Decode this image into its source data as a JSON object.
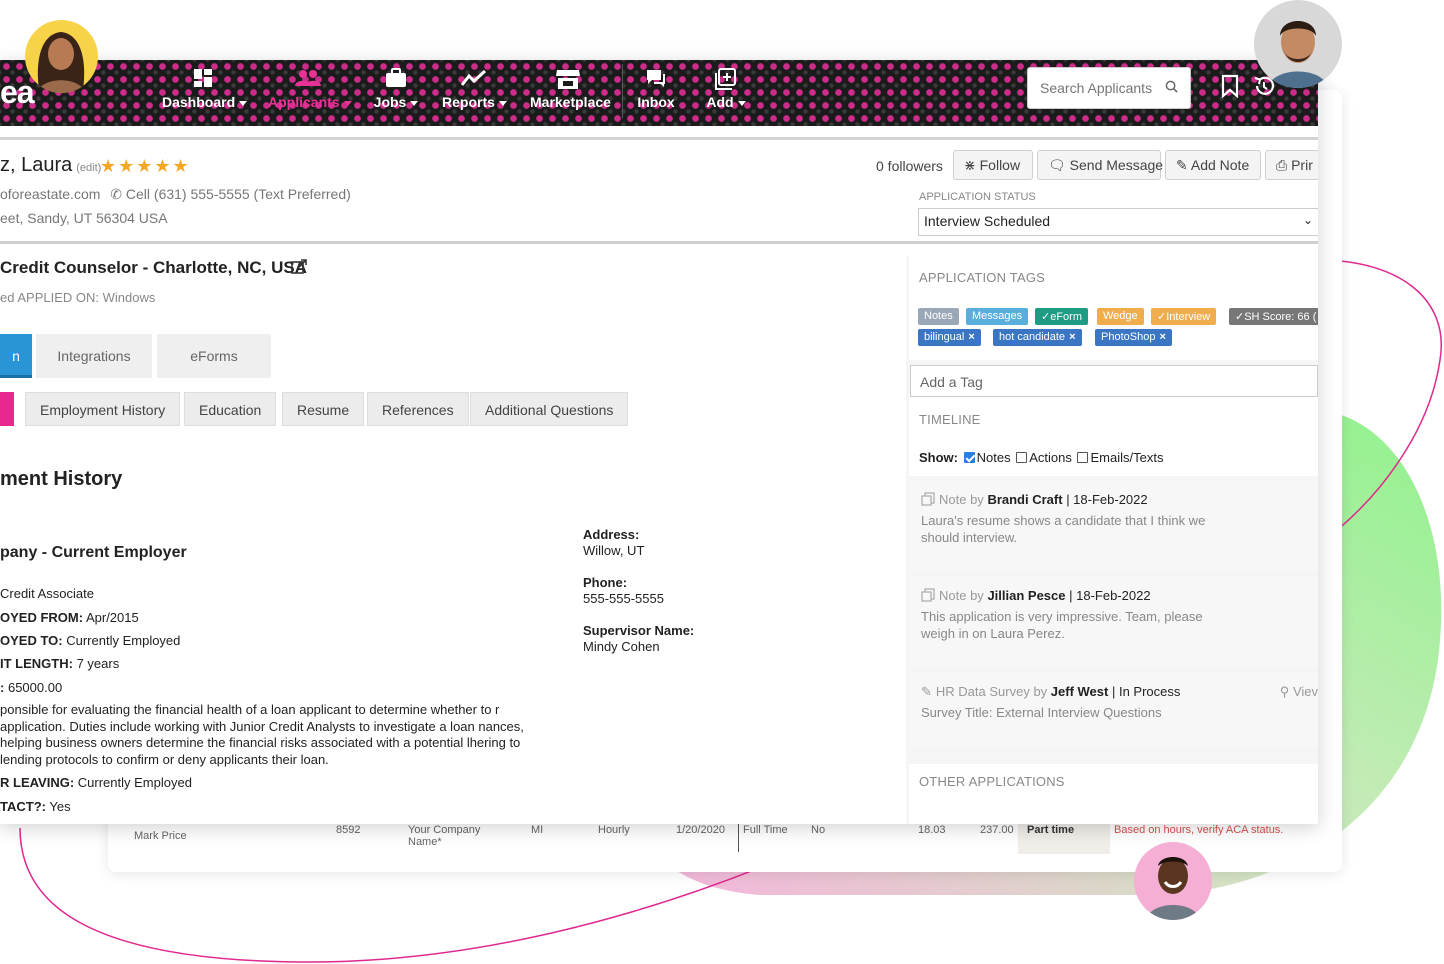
{
  "nav": {
    "logo": "ea",
    "items": [
      {
        "label": "Dashboard",
        "icon": "dashboard-icon",
        "caret": true
      },
      {
        "label": "Applicants",
        "icon": "applicants-icon",
        "caret": true,
        "active": true
      },
      {
        "label": "Jobs",
        "icon": "briefcase-icon",
        "caret": true
      },
      {
        "label": "Reports",
        "icon": "chart-line-icon",
        "caret": true
      },
      {
        "label": "Marketplace",
        "icon": "store-icon",
        "caret": false
      },
      {
        "label": "Inbox",
        "icon": "chat-icon",
        "caret": false
      },
      {
        "label": "Add",
        "icon": "add-icon",
        "caret": true
      }
    ],
    "search_placeholder": "Search Applicants"
  },
  "candidate": {
    "name": "z, Laura",
    "edit_label": "(edit)",
    "rating": 5,
    "email": "oforeastate.com",
    "phone": "Cell (631) 555-5555 (Text Preferred)",
    "address": "eet, Sandy, UT 56304 USA"
  },
  "header_actions": {
    "followers": "0 followers",
    "follow": "Follow",
    "send_message": "Send Message",
    "add_note": "Add Note",
    "print": "Prir"
  },
  "application_status": {
    "label": "APPLICATION STATUS",
    "value": "Interview Scheduled"
  },
  "job": {
    "title": "Credit Counselor - Charlotte, NC, USA",
    "applied_on": "ed APPLIED ON: Windows"
  },
  "main_tabs": [
    "n",
    "Integrations",
    "eForms"
  ],
  "sub_tabs": [
    "",
    "Employment History",
    "Education",
    "Resume",
    "References",
    "Additional Questions"
  ],
  "employment": {
    "section_title": "ment History",
    "company": "pany - Current Employer",
    "lines": [
      {
        "label": "",
        "value": "Credit Associate"
      },
      {
        "label": "OYED FROM:",
        "value": "Apr/2015"
      },
      {
        "label": "OYED TO:",
        "value": "Currently Employed"
      },
      {
        "label": "IT LENGTH:",
        "value": "7 years"
      },
      {
        "label": ":",
        "value": "65000.00"
      }
    ],
    "description": "ponsible for evaluating the financial health of a loan applicant to determine whether to r application. Duties include working with Junior Credit Analysts to investigate a loan nances, helping business owners determine the financial risks associated with a potential lhering to lending protocols to confirm or deny applicants their loan.",
    "leaving": {
      "label": "R LEAVING:",
      "value": "Currently Employed"
    },
    "contact": {
      "label": "TACT?:",
      "value": "Yes"
    },
    "address_label": "Address:",
    "address_value": "Willow, UT",
    "phone_label": "Phone:",
    "phone_value": "555-555-5555",
    "supervisor_label": "Supervisor Name:",
    "supervisor_value": "Mindy Cohen"
  },
  "sidebar": {
    "tags_title": "APPLICATION TAGS",
    "tags": [
      {
        "label": "Notes",
        "color": "#9aa7b6"
      },
      {
        "label": "Messages",
        "color": "#5aaedc"
      },
      {
        "label": "✓eForm",
        "color": "#1f9a83"
      },
      {
        "label": "Wedge",
        "color": "#f0ad4e"
      },
      {
        "label": "✓Interview",
        "color": "#f0ad4e"
      },
      {
        "label": "✓SH Score: 66 (",
        "color": "#777777"
      }
    ],
    "user_tags": [
      {
        "label": "bilingual",
        "color": "#3a76c4"
      },
      {
        "label": "hot candidate",
        "color": "#3a76c4"
      },
      {
        "label": "PhotoShop",
        "color": "#3a76c4"
      }
    ],
    "add_tag_placeholder": "Add a Tag",
    "timeline_title": "TIMELINE",
    "show_label": "Show:",
    "filters": [
      {
        "label": "Notes",
        "checked": true
      },
      {
        "label": "Actions",
        "checked": false
      },
      {
        "label": "Emails/Texts",
        "checked": false
      }
    ],
    "entries": [
      {
        "kind": "Note by",
        "author": "Brandi Craft",
        "date": "| 18-Feb-2022",
        "body": "Laura's resume shows a candidate that I think we should interview."
      },
      {
        "kind": "Note by",
        "author": "Jillian Pesce",
        "date": "| 18-Feb-2022",
        "body": "This application is very impressive. Team, please weigh in on Laura Perez."
      },
      {
        "kind": "HR Data Survey by",
        "author": "Jeff West",
        "date": "| In Process",
        "body": "Survey Title: External Interview Questions",
        "link": "Viev"
      }
    ],
    "other_apps_title": "OTHER APPLICATIONS"
  },
  "back_table_row": {
    "name": "Mark Price",
    "id": "8592",
    "company": "Your Company Name*",
    "state": "MI",
    "pay_type": "Hourly",
    "date": "1/20/2020",
    "emp_type": "Full Time",
    "flag": "No",
    "rate": "18.03",
    "hours": "237.00",
    "status": "Part time",
    "note": "Based on hours, verify ACA status."
  },
  "colors": {
    "brand_pink": "#e8278f",
    "tab_blue": "#2a95d4",
    "star": "#f5a623",
    "green_blob": "#8ef08e",
    "pink_blob": "#f5b8dc"
  }
}
